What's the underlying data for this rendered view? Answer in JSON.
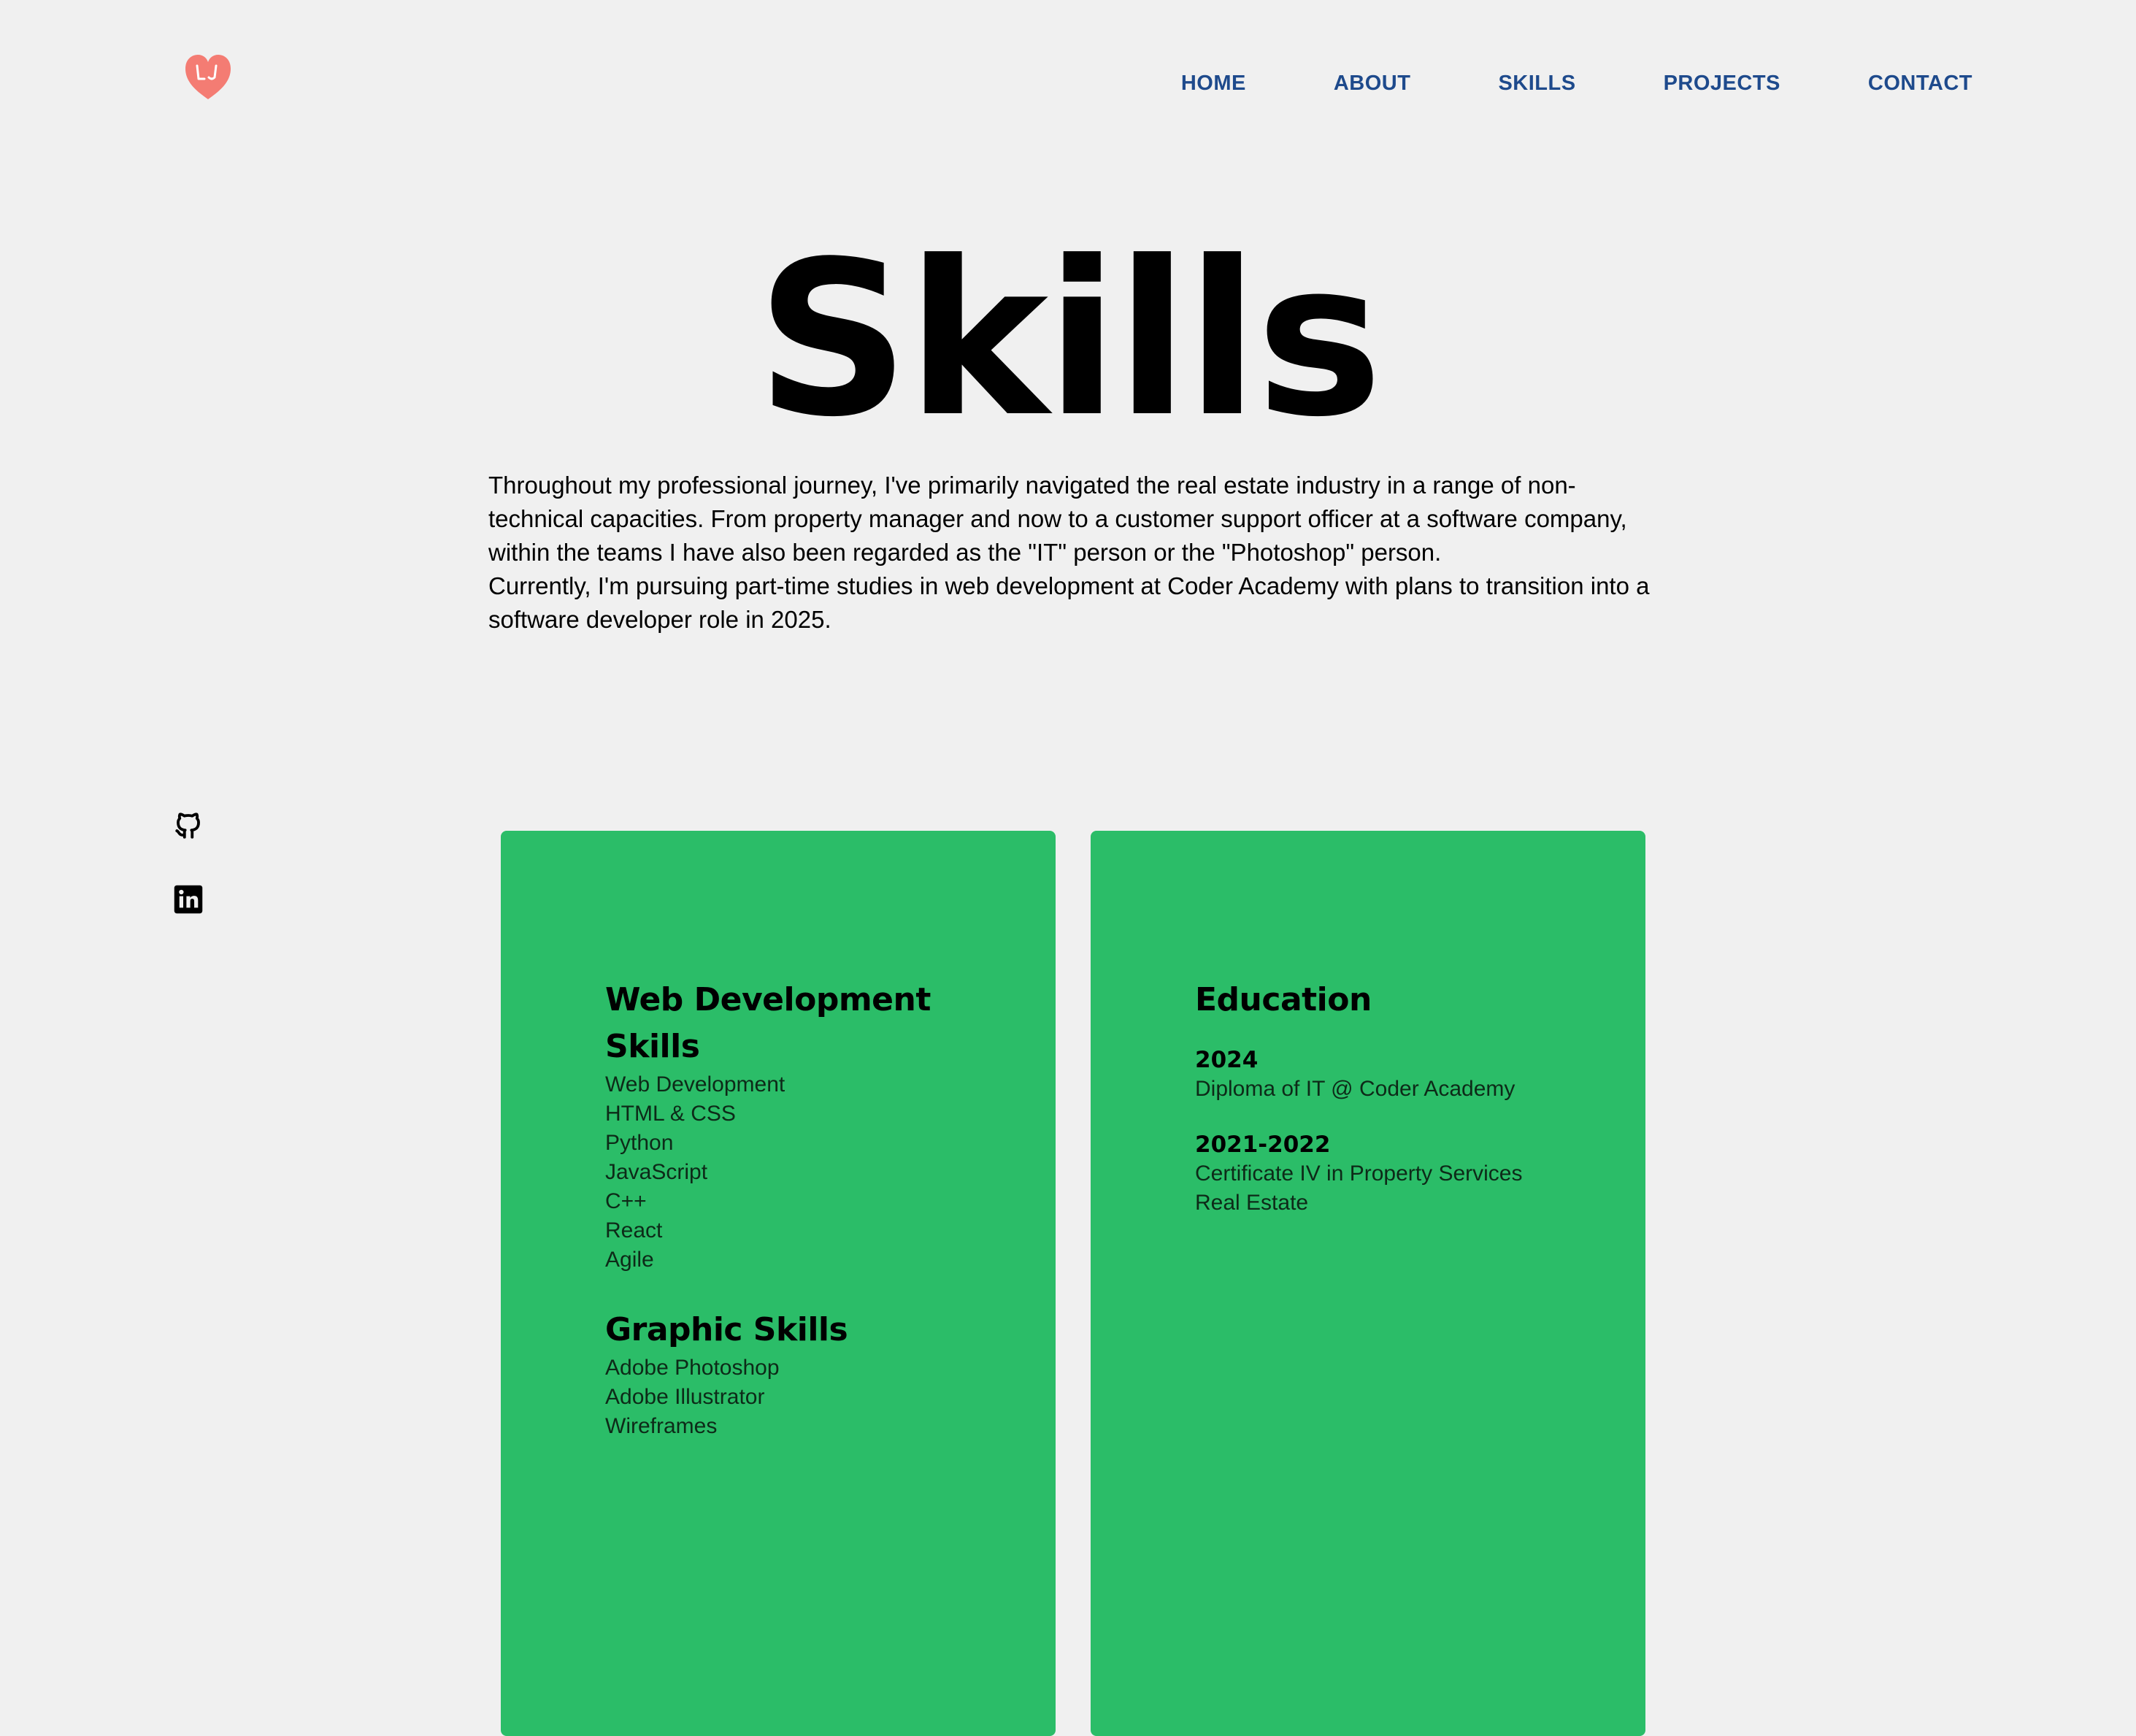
{
  "colors": {
    "background": "#f0f0f0",
    "nav_link": "#1e4a8c",
    "card": "#2bbd68",
    "logo": "#f47c73"
  },
  "header": {
    "logo_icon": "heart-logo-icon",
    "nav": [
      {
        "label": "HOME"
      },
      {
        "label": "ABOUT"
      },
      {
        "label": "SKILLS"
      },
      {
        "label": "PROJECTS"
      },
      {
        "label": "CONTACT"
      }
    ]
  },
  "main": {
    "title": "Skills",
    "intro": [
      "Throughout my professional journey, I've primarily navigated the real estate industry in a range of non-technical capacities. From property manager and now to a customer support officer at a software company, within the teams I have also been regarded as the \"IT\" person or the \"Photoshop\" person.",
      "Currently, I'm pursuing part-time studies in web development at Coder Academy with plans to transition into a software developer role in 2025."
    ]
  },
  "social": [
    {
      "icon": "github-icon"
    },
    {
      "icon": "linkedin-icon"
    }
  ],
  "skills_card": {
    "web_heading": "Web Development Skills",
    "web_items": [
      "Web Development",
      "HTML & CSS",
      "Python",
      "JavaScript",
      "C++",
      "React",
      "Agile"
    ],
    "graphic_heading": "Graphic Skills",
    "graphic_items": [
      "Adobe Photoshop",
      "Adobe Illustrator",
      "Wireframes"
    ]
  },
  "education_card": {
    "heading": "Education",
    "entries": [
      {
        "year": "2024",
        "lines": [
          "Diploma of IT @ Coder Academy"
        ]
      },
      {
        "year": "2021-2022",
        "lines": [
          "Certificate IV in Property Services",
          "Real Estate"
        ]
      }
    ]
  }
}
